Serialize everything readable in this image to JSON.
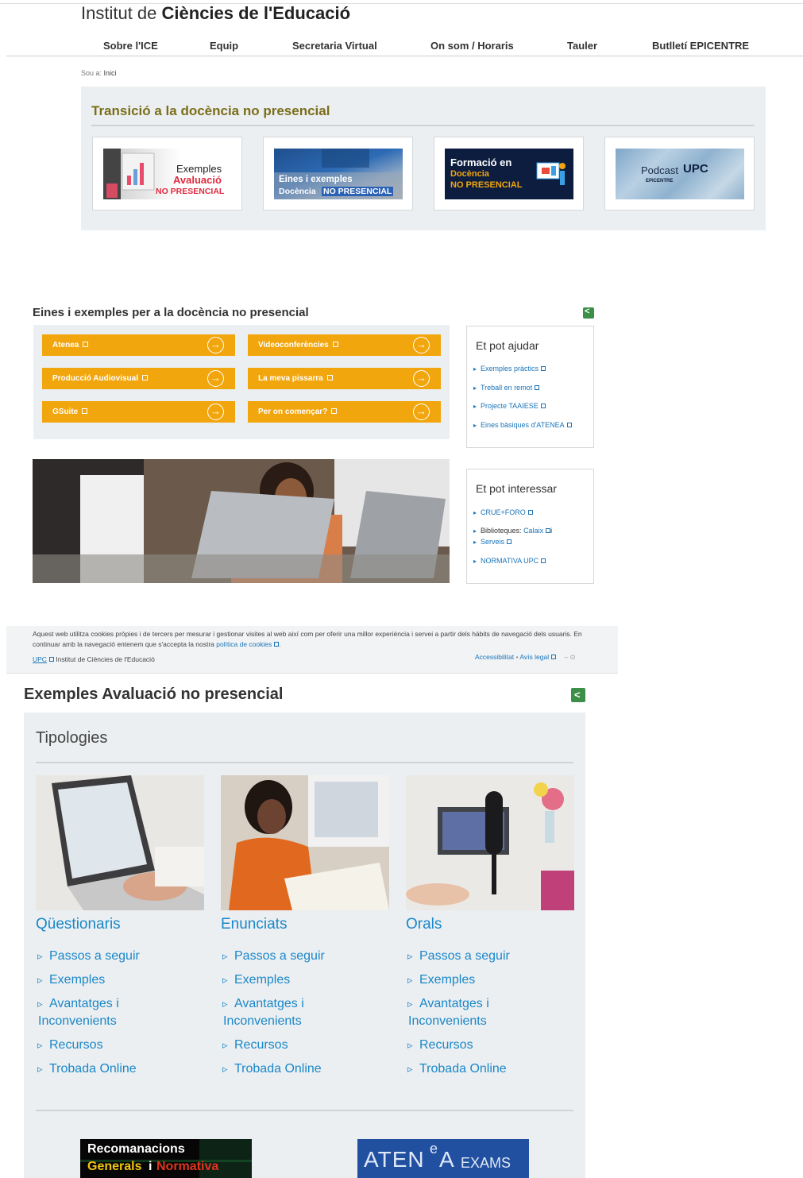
{
  "header": {
    "title_prefix": "Institut de ",
    "title_bold": "Ciències de l'Educació",
    "nav": [
      "Sobre l'ICE",
      "Equip",
      "Secretaria Virtual",
      "On som / Horaris",
      "Tauler",
      "Butlletí EPICENTRE"
    ],
    "breadcrumb_label": "Sou a:",
    "breadcrumb_current": "Inici"
  },
  "banner": {
    "title": "Transició a la docència no presencial",
    "tiles": [
      {
        "line1": "Exemples",
        "line2": "Avaluació",
        "line3": "NO PRESENCIAL"
      },
      {
        "line1": "Eines i exemples",
        "line2": "Docència",
        "line3": "NO PRESENCIAL"
      },
      {
        "line1": "Formació en",
        "line2": "Docència",
        "line3": "NO PRESENCIAL"
      },
      {
        "line1": "Podcast",
        "line2": "UPC",
        "line3": "EPICENTRE"
      }
    ]
  },
  "eines": {
    "title": "Eines i exemples per a la docència no presencial",
    "buttons": [
      "Atenea",
      "Videoconferències",
      "Producció Audiovisual",
      "La meva pissarra",
      "GSuite",
      "Per on començar?"
    ]
  },
  "ajudar": {
    "title": "Et pot ajudar",
    "items": [
      "Exemples pràctics",
      "Treball en remot",
      "Projecte TAAIESE",
      "Eines bàsiques d'ATENEA"
    ]
  },
  "interessar": {
    "title": "Et pot interessar",
    "items": [
      "CRUE+FORO",
      "Biblioteques:",
      "Calaix",
      "i",
      "Serveis",
      "NORMATIVA UPC"
    ]
  },
  "cookie": {
    "text": "Aquest web utilitza cookies pròpies i de tercers per mesurar i gestionar visites al web així com per oferir una millor experiència i servei a partir dels hàbits de navegació dels usuaris. En continuar amb la navegació entenem que s'accepta la nostra",
    "policy_link": "política de cookies",
    "upc": "UPC",
    "institute": "Institut de Ciències de l'Educació",
    "accessibilitat": "Accessibilitat",
    "avis_legal": "Avís legal"
  },
  "exemples": {
    "title": "Exemples Avaluació no presencial",
    "tipologies": "Tipologies",
    "columns": [
      {
        "name": "Qüestionaris",
        "links": [
          "Passos a seguir",
          "Exemples",
          "Avantatges i",
          "Inconvenients",
          "Recursos",
          "Trobada Online"
        ]
      },
      {
        "name": "Enunciats",
        "links": [
          "Passos a seguir",
          "Exemples",
          "Avantatges i",
          "Inconvenients",
          "Recursos",
          "Trobada Online"
        ]
      },
      {
        "name": "Orals",
        "links": [
          "Passos a seguir",
          "Exemples",
          "Avantatges i",
          "Inconvenients",
          "Recursos",
          "Trobada Online"
        ]
      }
    ],
    "banner_rec_line1": "Recomanacions",
    "banner_rec_line2a": "Generals",
    "banner_rec_line2b": "i",
    "banner_rec_line2c": "Normativa",
    "banner_atenea_a": "ATEN",
    "banner_atenea_e": "e",
    "banner_atenea_b": "A",
    "banner_atenea_c": "EXAMS"
  },
  "colors": {
    "orange": "#f2a60d",
    "link_blue": "#1a87c9",
    "banner_title": "#7a6e1a",
    "share_green": "#3c8f47"
  }
}
